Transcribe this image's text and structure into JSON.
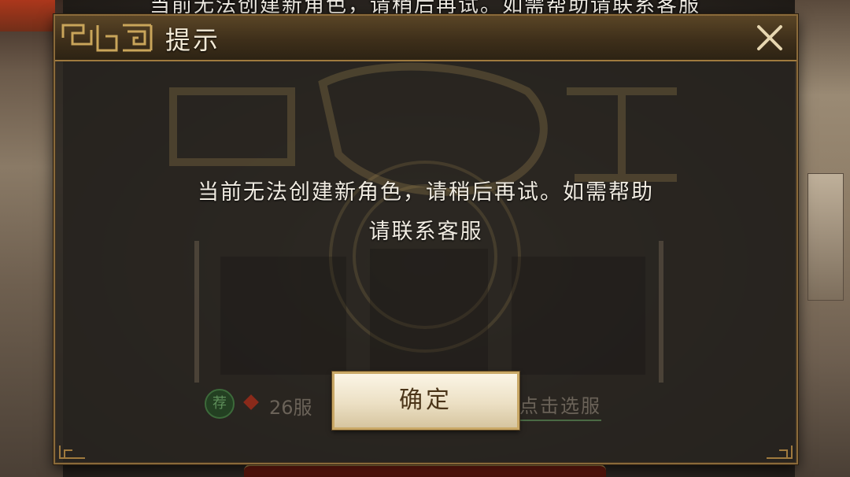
{
  "background": {
    "top_text": "当前无法创建新角色，请稍后再试。如需帮助请联系客服"
  },
  "dialog": {
    "title": "提示",
    "close_icon": "close-icon",
    "message_line1": "当前无法创建新角色，请稍后再试。如需帮助",
    "message_line2": "请联系客服",
    "confirm_label": "确定"
  },
  "server_selector": {
    "badge": "荐",
    "server_name": "26服",
    "select_link": "点击选服"
  },
  "colors": {
    "dialog_bg": "#28241f",
    "gold_border": "#8a6a3a",
    "title_text": "#f3ead6",
    "message_text": "#f1ece2",
    "button_text": "#4a3418"
  }
}
